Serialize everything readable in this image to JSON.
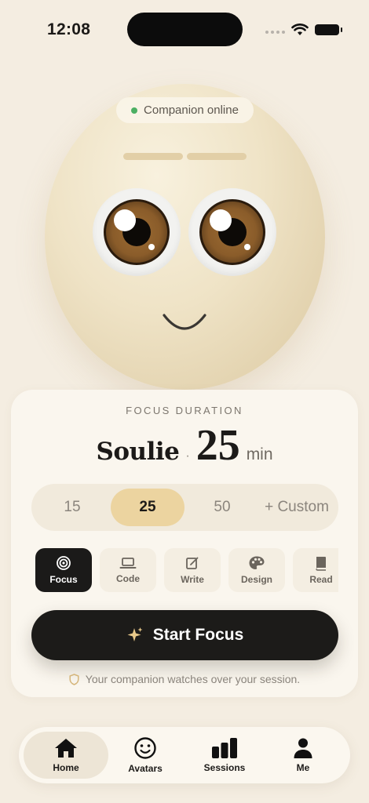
{
  "status_bar": {
    "time": "12:08"
  },
  "companion": {
    "status": "Companion online"
  },
  "focus_card": {
    "label": "FOCUS DURATION",
    "name": "Soulie",
    "separator": "·",
    "minutes": "25",
    "unit": "min",
    "durations": [
      {
        "label": "15",
        "selected": false
      },
      {
        "label": "25",
        "selected": true
      },
      {
        "label": "50",
        "selected": false
      },
      {
        "label": "+ Custom",
        "selected": false
      }
    ],
    "modes": [
      {
        "label": "Focus",
        "icon": "target-icon",
        "active": true
      },
      {
        "label": "Code",
        "icon": "laptop-icon",
        "active": false
      },
      {
        "label": "Write",
        "icon": "edit-icon",
        "active": false
      },
      {
        "label": "Design",
        "icon": "palette-icon",
        "active": false
      },
      {
        "label": "Read",
        "icon": "book-icon",
        "active": false
      }
    ],
    "start_label": "Start Focus",
    "note": "Your companion watches over your session."
  },
  "colors": {
    "accent": "#ecd4a0",
    "dark": "#1c1b19",
    "online": "#4caf63",
    "background": "#f4ede1"
  },
  "tabbar": [
    {
      "label": "Home",
      "icon": "home-icon",
      "active": true
    },
    {
      "label": "Avatars",
      "icon": "smiley-icon",
      "active": false
    },
    {
      "label": "Sessions",
      "icon": "bar-chart-icon",
      "active": false
    },
    {
      "label": "Me",
      "icon": "person-icon",
      "active": false
    }
  ]
}
